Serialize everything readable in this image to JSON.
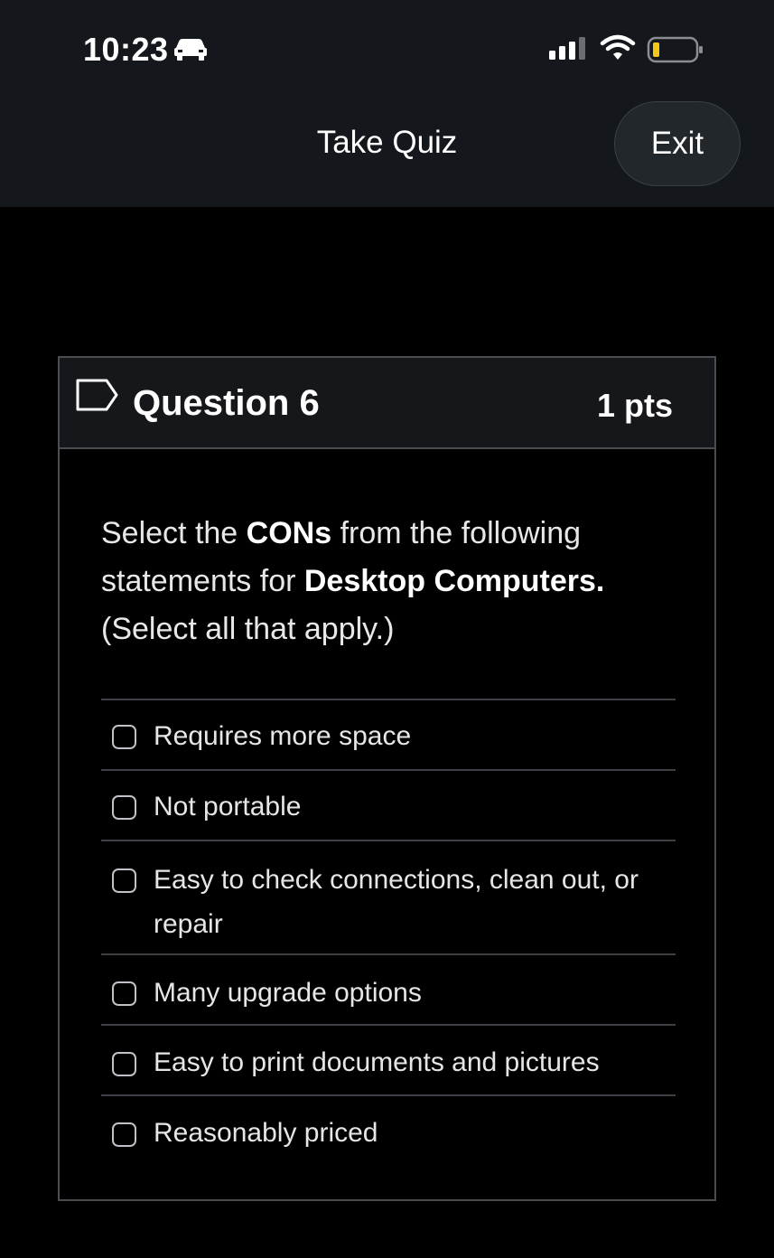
{
  "status_bar": {
    "time": "10:23",
    "icons": [
      "car-icon",
      "signal-icon",
      "wifi-icon",
      "battery-icon"
    ],
    "battery_color": "#f5c518"
  },
  "nav": {
    "title": "Take Quiz",
    "exit_label": "Exit"
  },
  "question": {
    "title": "Question 6",
    "points": "1 pts",
    "prompt": {
      "part1": "Select the ",
      "bold1": "CONs",
      "part2": " from the following statements for ",
      "bold2": "Desktop Computers.",
      "part3": " (Select all that apply.)"
    },
    "answers": [
      {
        "label": "Requires more space",
        "checked": false
      },
      {
        "label": "Not portable",
        "checked": false
      },
      {
        "label": "Easy to check connections, clean out, or repair",
        "checked": false
      },
      {
        "label": "Many upgrade options",
        "checked": false
      },
      {
        "label": "Easy to print documents and pictures",
        "checked": false
      },
      {
        "label": "Reasonably priced",
        "checked": false
      }
    ]
  },
  "colors": {
    "background": "#000000",
    "header": "#14171b",
    "card_border": "#4a4d52"
  }
}
